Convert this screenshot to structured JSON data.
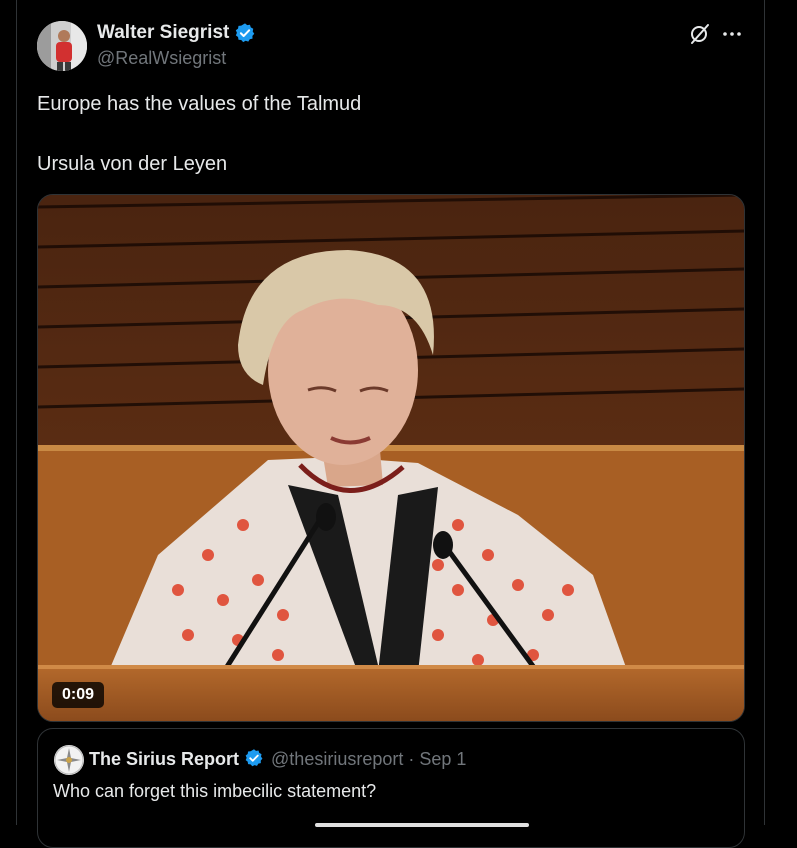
{
  "author": {
    "name": "Walter Siegrist",
    "handle": "@RealWsiegrist",
    "verified": true
  },
  "icons": {
    "verified": "verified-badge-icon",
    "grok": "grok-icon",
    "more": "more-options-icon"
  },
  "tweet": {
    "line1": "Europe has the values of the Talmud",
    "line2": "Ursula von der Leyen"
  },
  "media": {
    "type": "video",
    "duration": "0:09"
  },
  "quoted": {
    "name": "The Sirius Report",
    "handle": "@thesiriusreport",
    "separator": "·",
    "date": "Sep 1",
    "text": "Who can forget this imbecilic statement?"
  },
  "colors": {
    "background": "#000000",
    "text": "#e7e9ea",
    "secondary": "#71767b",
    "verified": "#1d9bf0",
    "border": "#2f3336"
  }
}
